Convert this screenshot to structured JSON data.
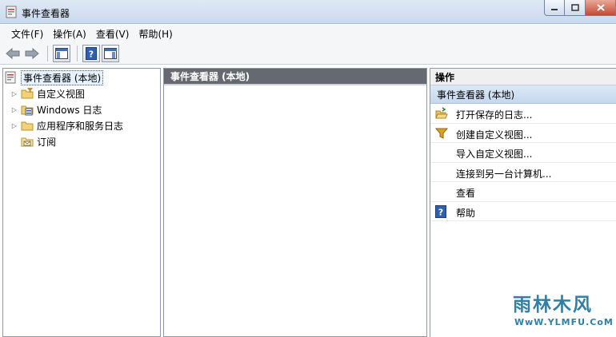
{
  "window": {
    "title": "事件查看器"
  },
  "menu": [
    "文件(F)",
    "操作(A)",
    "查看(V)",
    "帮助(H)"
  ],
  "tree": {
    "root": "事件查看器 (本地)",
    "items": [
      {
        "label": "自定义视图",
        "icon": "folder-filter-icon"
      },
      {
        "label": "Windows 日志",
        "icon": "folder-log-icon"
      },
      {
        "label": "应用程序和服务日志",
        "icon": "folder-icon"
      },
      {
        "label": "订阅",
        "icon": "subscription-icon"
      }
    ]
  },
  "middle": {
    "header": "事件查看器 (本地)"
  },
  "actions": {
    "header": "操作",
    "section": "事件查看器 (本地)",
    "items": [
      {
        "label": "打开保存的日志...",
        "icon": "open-folder-icon"
      },
      {
        "label": "创建自定义视图...",
        "icon": "filter-icon"
      },
      {
        "label": "导入自定义视图...",
        "icon": ""
      },
      {
        "label": "连接到另一台计算机...",
        "icon": ""
      },
      {
        "label": "查看",
        "icon": ""
      },
      {
        "label": "帮助",
        "icon": "help-icon"
      }
    ]
  },
  "watermark": {
    "title": "雨林木风",
    "url": "WwW.YLMFU.CoM"
  },
  "colors": {
    "titlebar": "#c9d9ee",
    "pane_header": "#666a70",
    "action_section": "#c5d8ee",
    "accent": "#2f7fa7"
  }
}
